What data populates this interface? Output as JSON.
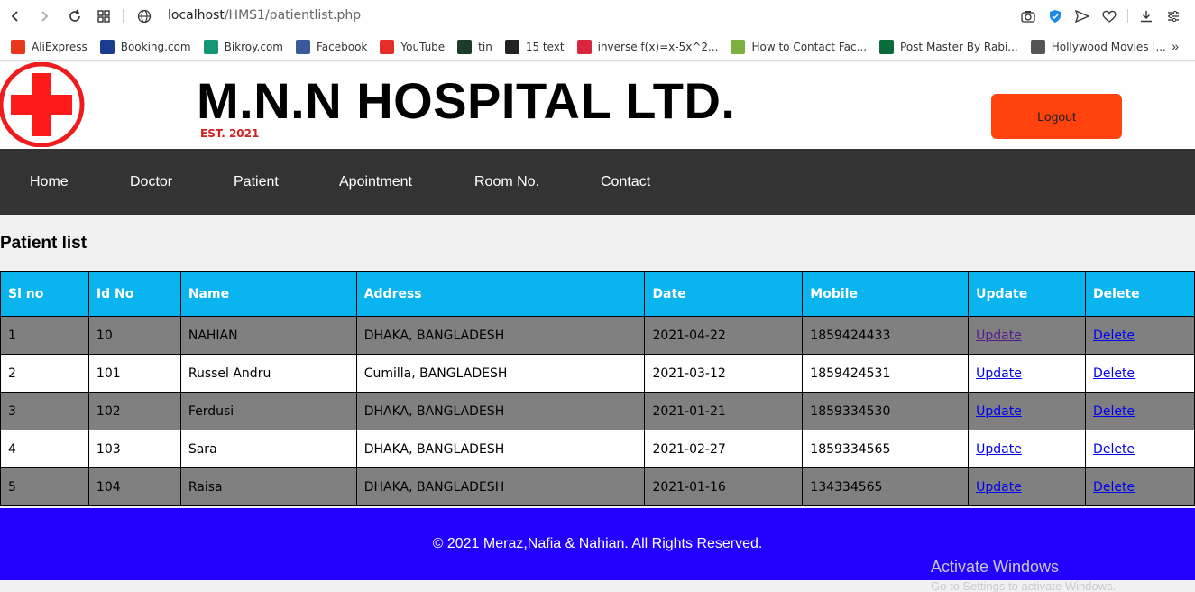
{
  "browser": {
    "url_host": "localhost",
    "url_path": "/HMS1/patientlist.php",
    "bookmarks": [
      {
        "label": "AliExpress",
        "icon": "aliexpress-icon",
        "color": "#e8391f"
      },
      {
        "label": "Booking.com",
        "icon": "booking-icon",
        "color": "#1a3d8f"
      },
      {
        "label": "Bikroy.com",
        "icon": "bikroy-icon",
        "color": "#149777"
      },
      {
        "label": "Facebook",
        "icon": "facebook-icon",
        "color": "#3b5998"
      },
      {
        "label": "YouTube",
        "icon": "youtube-icon",
        "color": "#e52d27"
      },
      {
        "label": "tin",
        "icon": "tin-icon",
        "color": "#1d3b2b"
      },
      {
        "label": "15 text",
        "icon": "text-icon",
        "color": "#222222"
      },
      {
        "label": "inverse f(x)=x-5x^2...",
        "icon": "symbolab-icon",
        "color": "#d7263d"
      },
      {
        "label": "How to Contact Fac...",
        "icon": "map-pin-icon",
        "color": "#7bb041"
      },
      {
        "label": "Post Master By Rabi...",
        "icon": "flag-icon",
        "color": "#0a6a3a"
      },
      {
        "label": "Hollywood Movies |...",
        "icon": "document-icon",
        "color": "#555555"
      }
    ]
  },
  "header": {
    "title": "M.N.N HOSPITAL LTD.",
    "est": "EST. 2021",
    "logout_label": "Logout",
    "logo_color": "#ff1a1a",
    "accent": "#ff420e"
  },
  "nav": [
    "Home",
    "Doctor",
    "Patient",
    "Apointment",
    "Room No.",
    "Contact"
  ],
  "main": {
    "title": "Patient list",
    "columns": [
      "Sl no",
      "Id No",
      "Name",
      "Address",
      "Date",
      "Mobile",
      "Update",
      "Delete"
    ],
    "rows": [
      {
        "sl": "1",
        "id": "10",
        "name": "NAHIAN",
        "address": "DHAKA, BANGLADESH",
        "date": "2021-04-22",
        "mobile": "1859424433",
        "update": "Update",
        "delete": "Delete"
      },
      {
        "sl": "2",
        "id": "101",
        "name": "Russel Andru",
        "address": "Cumilla, BANGLADESH",
        "date": "2021-03-12",
        "mobile": "1859424531",
        "update": "Update",
        "delete": "Delete"
      },
      {
        "sl": "3",
        "id": "102",
        "name": "Ferdusi",
        "address": "DHAKA, BANGLADESH",
        "date": "2021-01-21",
        "mobile": "1859334530",
        "update": "Update",
        "delete": "Delete"
      },
      {
        "sl": "4",
        "id": "103",
        "name": "Sara",
        "address": "DHAKA, BANGLADESH",
        "date": "2021-02-27",
        "mobile": "1859334565",
        "update": "Update",
        "delete": "Delete"
      },
      {
        "sl": "5",
        "id": "104",
        "name": "Raisa",
        "address": "DHAKA, BANGLADESH",
        "date": "2021-01-16",
        "mobile": "134334565",
        "update": "Update",
        "delete": "Delete"
      }
    ]
  },
  "footer": {
    "text": "© 2021 Meraz,Nafia & Nahian. All Rights Reserved.",
    "color": "#2200ff"
  },
  "os": {
    "watermark": "Activate Windows",
    "watermark_sub": "Go to Settings to activate Windows."
  }
}
